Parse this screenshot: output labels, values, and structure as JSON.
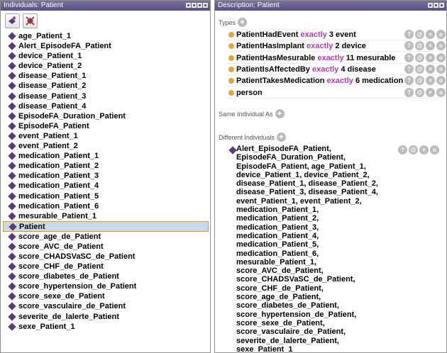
{
  "left_panel": {
    "title": "Individuals: Patient",
    "toolbar": {
      "add_icon": "add-individual-icon",
      "delete_icon": "delete-individual-icon"
    },
    "items": [
      "age_Patient_1",
      "Alert_EpisodeFA_Patient",
      "device_Patient_1",
      "device_Patient_2",
      "disease_Patient_1",
      "disease_Patient_2",
      "disease_Patient_3",
      "disease_Patient_4",
      "EpisodeFA_Duration_Patient",
      "EpisodeFA_Patient",
      "event_Patient_1",
      "event_Patient_2",
      "medication_Patient_1",
      "medication_Patient_2",
      "medication_Patient_3",
      "medication_Patient_4",
      "medication_Patient_5",
      "medication_Patient_6",
      "mesurable_Patient_1",
      "Patient",
      "score_age_de_Patient",
      "score_AVC_de_Patient",
      "score_CHADSVaSC_de_Patient",
      "score_CHF_de_Patient",
      "score_diabetes_de_Patient",
      "score_hypertension_de_Patient",
      "score_sexe_de_Patient",
      "score_vasculaire_de_Patient",
      "severite_de_lalerte_Patient",
      "sexe_Patient_1"
    ],
    "selected": "Patient"
  },
  "right_panel": {
    "title": "Description: Patient",
    "types_label": "Types",
    "types": [
      {
        "prop": "PatientHadEvent",
        "kw": "exactly",
        "rest": "3 event"
      },
      {
        "prop": "PatientHasImplant",
        "kw": "exactly",
        "rest": "2 device"
      },
      {
        "prop": "PatientHasMesurable",
        "kw": "exactly",
        "rest": "11 mesurable"
      },
      {
        "prop": "PatientIsAffectedBy",
        "kw": "exactly",
        "rest": "4 disease"
      },
      {
        "prop": "PatientTakesMedication",
        "kw": "exactly",
        "rest": "6 medication"
      },
      {
        "prop": "person",
        "kw": "",
        "rest": ""
      }
    ],
    "same_label": "Same Individual As",
    "different_label": "Different Individuals",
    "different_lines": [
      "Alert_EpisodeFA_Patient,",
      "EpisodeFA_Duration_Patient,",
      "EpisodeFA_Patient, age_Patient_1,",
      "device_Patient_1, device_Patient_2,",
      "disease_Patient_1, disease_Patient_2,",
      "disease_Patient_3, disease_Patient_4,",
      "event_Patient_1, event_Patient_2,",
      "medication_Patient_1,",
      "medication_Patient_2,",
      "medication_Patient_3,",
      "medication_Patient_4,",
      "medication_Patient_5,",
      "medication_Patient_6,",
      "mesurable_Patient_1,",
      "score_AVC_de_Patient,",
      "score_CHADSVaSC_de_Patient,",
      "score_CHF_de_Patient,",
      "score_age_de_Patient,",
      "score_diabetes_de_Patient,",
      "score_hypertension_de_Patient,",
      "score_sexe_de_Patient,",
      "score_vasculaire_de_Patient,",
      "severite_de_lalerte_Patient,",
      "sexe_Patient_1"
    ],
    "row_buttons": [
      "?",
      "@",
      "×",
      "o"
    ]
  },
  "colors": {
    "titlebar": "#5a4f86",
    "keyword": "#b73ab5",
    "type_dot": "#e7a733",
    "individual": "#5b3a7a",
    "selection": "#c8daf1"
  }
}
